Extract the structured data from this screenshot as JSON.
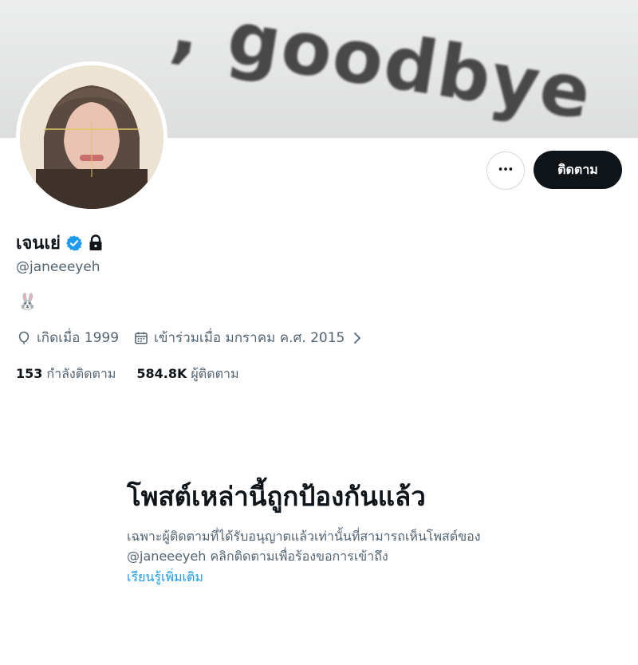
{
  "banner": {
    "text": ", goodbye"
  },
  "profile": {
    "display_name": "เจนเย่",
    "handle": "@janeeeyeh",
    "bio_emoji": "🐰",
    "birth": "เกิดเมื่อ 1999",
    "joined": "เข้าร่วมเมื่อ มกราคม ค.ศ. 2015",
    "following_count": "153",
    "following_label": "กำลังติดตาม",
    "followers_count": "584.8K",
    "followers_label": "ผู้ติดตาม"
  },
  "actions": {
    "follow_label": "ติดตาม"
  },
  "protected": {
    "title": "โพสต์เหล่านี้ถูกป้องกันแล้ว",
    "body": "เฉพาะผู้ติดตามที่ได้รับอนุญาตแล้วเท่านั้นที่สามารถเห็นโพสต์ของ @janeeeyeh คลิกติดตามเพื่อร้องขอการเข้าถึง",
    "learn_more": "เรียนรู้เพิ่มเติม"
  },
  "icons": {
    "verified": "verified-badge-icon",
    "lock": "lock-icon",
    "more": "more-horizontal-icon",
    "birth": "balloon-icon",
    "joined": "calendar-icon",
    "chevron": "chevron-right-icon"
  },
  "colors": {
    "accent": "#1d9bf0",
    "text": "#0f1419",
    "secondary": "#536471",
    "button_dark": "#0f1419"
  }
}
